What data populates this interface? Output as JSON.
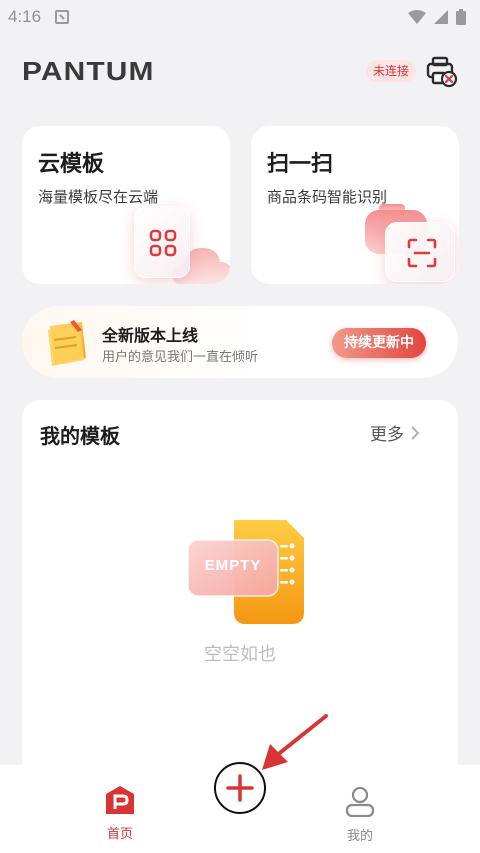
{
  "status_bar": {
    "time": "4:16"
  },
  "header": {
    "brand": "PANTUM",
    "connection_status": "未连接"
  },
  "cards": {
    "template": {
      "title": "云模板",
      "subtitle": "海量模板尽在云端"
    },
    "scan": {
      "title": "扫一扫",
      "subtitle": "商品条码智能识别"
    }
  },
  "banner": {
    "title": "全新版本上线",
    "subtitle": "用户的意见我们一直在倾听",
    "button": "持续更新中"
  },
  "my_templates": {
    "title": "我的模板",
    "more": "更多",
    "empty_badge": "EMPTY",
    "empty_text": "空空如也"
  },
  "bottom_nav": {
    "home": "首页",
    "mine": "我的"
  },
  "colors": {
    "accent": "#d83434",
    "background": "#f2f2f4",
    "card": "#ffffff",
    "empty_orange": "#f7a21b"
  },
  "icons": [
    "notification-icon",
    "wifi-icon",
    "signal-icon",
    "battery-icon",
    "printer-disconnected-icon",
    "grid-icon",
    "cloud-icon",
    "scan-icon",
    "note-icon",
    "chevron-right-icon",
    "empty-folder-icon",
    "home-icon",
    "plus-icon",
    "user-icon",
    "annotation-arrow-icon"
  ]
}
